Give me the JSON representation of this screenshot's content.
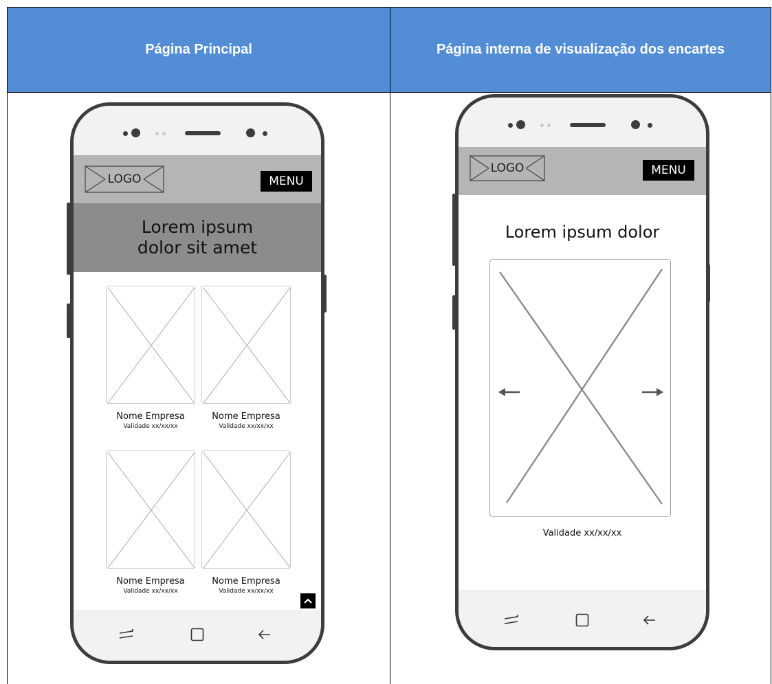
{
  "table": {
    "col_left_header": "Página Principal",
    "col_right_header": "Página interna de visualização dos encartes",
    "header_color": "#538dd5"
  },
  "home": {
    "logo": "LOGO",
    "menu": "MENU",
    "hero_title": "Lorem ipsum dolor sit amet",
    "cards": [
      {
        "name": "Nome Empresa",
        "validity": "Validade xx/xx/xx"
      },
      {
        "name": "Nome Empresa",
        "validity": "Validade xx/xx/xx"
      },
      {
        "name": "Nome Empresa",
        "validity": "Validade xx/xx/xx"
      },
      {
        "name": "Nome Empresa",
        "validity": "Validade xx/xx/xx"
      }
    ],
    "scroll_top_icon": "chevron-up-icon"
  },
  "inner": {
    "logo": "LOGO",
    "menu": "MENU",
    "title": "Lorem ipsum dolor",
    "validity": "Validade xx/xx/xx",
    "prev_icon": "arrow-left-icon",
    "next_icon": "arrow-right-icon"
  },
  "navbar_icons": [
    "recent-apps-icon",
    "home-icon",
    "back-icon"
  ]
}
